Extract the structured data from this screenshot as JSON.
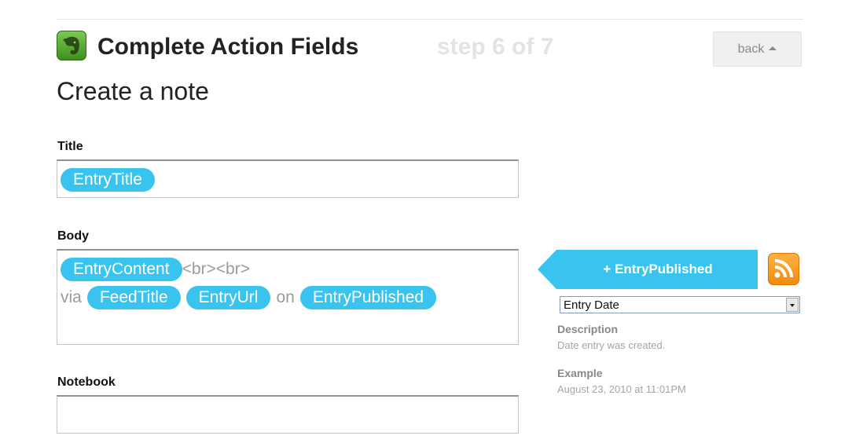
{
  "header": {
    "title": "Complete Action Fields",
    "step": "step 6 of 7",
    "back_label": "back",
    "app_icon": "evernote-elephant-icon"
  },
  "action": {
    "title": "Create a note"
  },
  "fields": {
    "title": {
      "label": "Title",
      "tokens": [
        "EntryTitle"
      ]
    },
    "body": {
      "label": "Body",
      "line1": {
        "token1": "EntryContent",
        "text": "<br><br>"
      },
      "line2": {
        "text1": "via",
        "token1": "FeedTitle",
        "token2": "EntryUrl",
        "text2": "on",
        "token3": "EntryPublished"
      }
    },
    "notebook": {
      "label": "Notebook",
      "value": ""
    }
  },
  "ingredient_panel": {
    "add_label": "+ EntryPublished",
    "channel_icon": "rss-feed-icon",
    "selected_ingredient": "Entry Date",
    "description_label": "Description",
    "description": "Date entry was created.",
    "example_label": "Example",
    "example": "August 23, 2010 at 11:01PM"
  },
  "colors": {
    "pill": "#39c4f0",
    "step_text": "#e3e3e3",
    "rss": "#f08a0a",
    "evernote": "#5aae31"
  }
}
